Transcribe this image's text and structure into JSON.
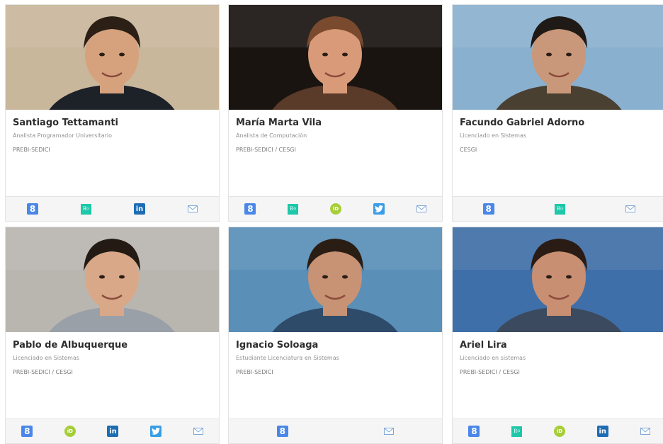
{
  "people": [
    {
      "name": "Santiago Tettamanti",
      "title": "Analista Programador Universitario",
      "org": "PREBI-SEDICI",
      "links": [
        "google-scholar",
        "researchgate",
        "linkedin",
        "email"
      ],
      "photo": {
        "bg": "#c9b79c",
        "skin": "#d6a27e",
        "hair": "#2b1f16",
        "shirt": "#1d2128"
      }
    },
    {
      "name": "María Marta Vila",
      "title": "Analista de Computación",
      "org": "PREBI-SEDICI / CESGI",
      "links": [
        "google-scholar",
        "researchgate",
        "orcid",
        "twitter",
        "email"
      ],
      "photo": {
        "bg": "#1a1411",
        "skin": "#d89a78",
        "hair": "#7a4a2e",
        "shirt": "#5a3a28"
      }
    },
    {
      "name": "Facundo Gabriel Adorno",
      "title": "Licenciado en Sistemas",
      "org": "CESGI",
      "links": [
        "google-scholar",
        "researchgate",
        "email"
      ],
      "photo": {
        "bg": "#8ab0d0",
        "skin": "#c9977a",
        "hair": "#1f1a16",
        "shirt": "#4a4032"
      }
    },
    {
      "name": "Pablo de Albuquerque",
      "title": "Licenciado en Sistemas",
      "org": "PREBI-SEDICI / CESGI",
      "links": [
        "google-scholar",
        "orcid",
        "linkedin",
        "twitter",
        "email"
      ],
      "photo": {
        "bg": "#b9b6b0",
        "skin": "#d8a888",
        "hair": "#231a14",
        "shirt": "#9aa0a8"
      }
    },
    {
      "name": "Ignacio Soloaga",
      "title": "Estudiante Licenciatura en Sistemas",
      "org": "PREBI-SEDICI",
      "links": [
        "google-scholar",
        "email"
      ],
      "photo": {
        "bg": "#5a8fb8",
        "skin": "#c89274",
        "hair": "#2a1d14",
        "shirt": "#2f4b6a"
      }
    },
    {
      "name": "Ariel Lira",
      "title": "Licenciado en sistemas",
      "org": "PREBI-SEDICI / CESGI",
      "links": [
        "google-scholar",
        "researchgate",
        "orcid",
        "linkedin",
        "email"
      ],
      "photo": {
        "bg": "#3f6fa8",
        "skin": "#c98f72",
        "hair": "#2a1c14",
        "shirt": "#3b4a5e"
      }
    }
  ],
  "icons": {
    "google-scholar": {
      "glyph": "8"
    },
    "researchgate": {
      "glyph": "R"
    },
    "linkedin": {
      "glyph": "in"
    },
    "orcid": {
      "glyph": "iD"
    },
    "twitter": {
      "glyph": ""
    },
    "email": {
      "glyph": ""
    }
  }
}
